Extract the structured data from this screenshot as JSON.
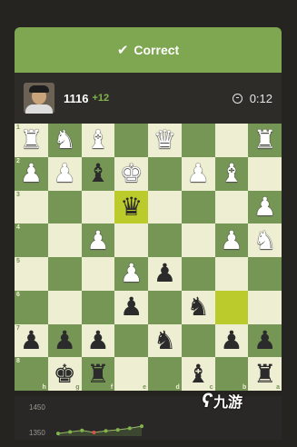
{
  "banner": {
    "text": "Correct",
    "icon": "checkmark-icon",
    "color": "#7fa650"
  },
  "player": {
    "rating": "1116",
    "delta": "+12",
    "avatar": "player-avatar"
  },
  "timer": {
    "value": "0:12",
    "icon": "clock-icon"
  },
  "board": {
    "light_color": "#eeeed2",
    "dark_color": "#769656",
    "highlight_color": "#bbcb2b",
    "ranks": [
      "1",
      "2",
      "3",
      "4",
      "5",
      "6",
      "7",
      "8"
    ],
    "files": [
      "h",
      "g",
      "f",
      "e",
      "d",
      "c",
      "b",
      "a"
    ],
    "highlighted": [
      [
        2,
        3
      ],
      [
        5,
        6
      ]
    ],
    "rows": [
      [
        "wR",
        "wN",
        "wB",
        "",
        "wQ",
        "",
        "",
        "wR"
      ],
      [
        "wP",
        "wP",
        "bB",
        "wK",
        "",
        "wP",
        "wB",
        ""
      ],
      [
        "",
        "",
        "",
        "bQ",
        "",
        "",
        "",
        "wP"
      ],
      [
        "",
        "",
        "wP",
        "",
        "",
        "",
        "wP",
        "wN"
      ],
      [
        "",
        "",
        "",
        "wP",
        "bP",
        "",
        "",
        ""
      ],
      [
        "",
        "",
        "",
        "bP",
        "",
        "bN",
        "",
        ""
      ],
      [
        "bP",
        "bP",
        "bP",
        "",
        "bN",
        "",
        "bP",
        "bP"
      ],
      [
        "",
        "bK",
        "bR",
        "",
        "",
        "bB",
        "",
        "bR"
      ]
    ]
  },
  "graph": {
    "labels": [
      "1450",
      "1350"
    ],
    "points": [
      {
        "rating": 1330,
        "result": "win"
      },
      {
        "rating": 1336,
        "result": "win"
      },
      {
        "rating": 1342,
        "result": "win"
      },
      {
        "rating": 1334,
        "result": "loss"
      },
      {
        "rating": 1340,
        "result": "win"
      },
      {
        "rating": 1344,
        "result": "win"
      },
      {
        "rating": 1350,
        "result": "win"
      },
      {
        "rating": 1358,
        "result": "win"
      }
    ]
  },
  "watermark": {
    "text": "九游"
  }
}
